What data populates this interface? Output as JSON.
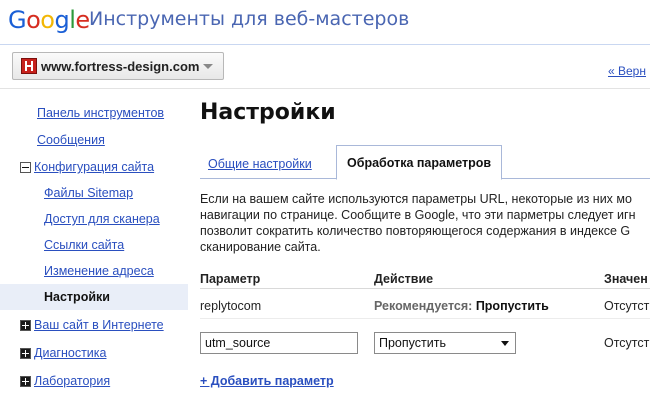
{
  "header": {
    "logo_letters": [
      "G",
      "o",
      "o",
      "g",
      "l",
      "e"
    ],
    "product": "Инструменты для веб-мастеров"
  },
  "site_selector": {
    "value": "www.fortress-design.com"
  },
  "back_link": "« Верн",
  "sidebar": {
    "items": [
      {
        "label": "Панель инструментов"
      },
      {
        "label": "Сообщения"
      },
      {
        "label": "Конфигурация сайта"
      },
      {
        "label": "Файлы Sitemap"
      },
      {
        "label": "Доступ для сканера"
      },
      {
        "label": "Ссылки сайта"
      },
      {
        "label": "Изменение адреса"
      },
      {
        "label": "Настройки"
      },
      {
        "label": "Ваш сайт в Интернете"
      },
      {
        "label": "Диагностика"
      },
      {
        "label": "Лаборатория"
      }
    ]
  },
  "main": {
    "title": "Настройки",
    "tabs": [
      {
        "label": "Общие настройки"
      },
      {
        "label": "Обработка параметров"
      }
    ],
    "description": [
      "Если на вашем сайте используются параметры URL, некоторые из них мо",
      "навигации по странице. Сообщите в Google, что эти парметры следует игн",
      "позволит сократить количество повторяющегося содержания в индексе G",
      "сканирование сайта."
    ],
    "table": {
      "headers": [
        "Параметр",
        "Действие",
        "Значен"
      ],
      "rows": [
        {
          "param": "replytocom",
          "action_label": "Рекомендуется:",
          "action_value": "Пропустить",
          "value": "Отсутст"
        }
      ],
      "new_row": {
        "param": "utm_source",
        "action": "Пропустить",
        "value": "Отсутст"
      }
    },
    "add_param": "+ Добавить параметр"
  }
}
